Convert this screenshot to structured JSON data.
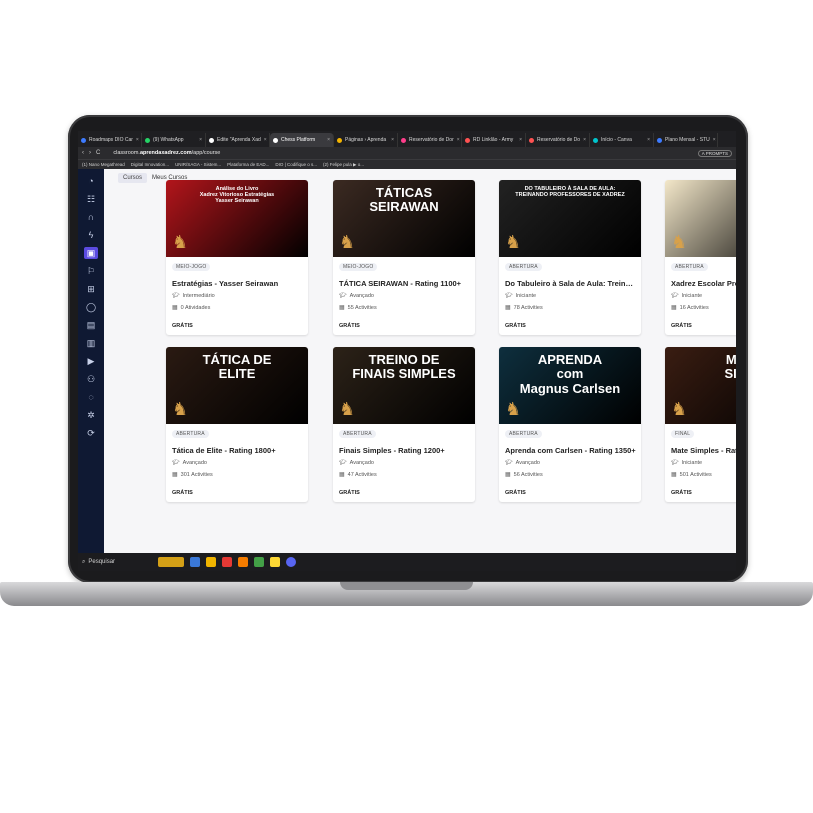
{
  "browser": {
    "tabs": [
      {
        "label": "Roadmaps DIO Car",
        "color": "#3d7bff"
      },
      {
        "label": "(9) WhatsApp",
        "color": "#25d366"
      },
      {
        "label": "Edite \"Aprenda Xad",
        "color": "#ffffff"
      },
      {
        "label": "Chess Platform",
        "color": "#ffffff",
        "active": true
      },
      {
        "label": "Páginas › Aprenda",
        "color": "#f4b400"
      },
      {
        "label": "Reservatório de Dor",
        "color": "#ff3d8b"
      },
      {
        "label": "RD Linklão - Army",
        "color": "#ff5252"
      },
      {
        "label": "Reservatório de Do",
        "color": "#ff5252"
      },
      {
        "label": "Início - Canva",
        "color": "#00c4cc"
      },
      {
        "label": "Plano Mensal - STU",
        "color": "#3d7bff"
      }
    ],
    "close_glyph": "×",
    "nav_back": "‹",
    "nav_forward": "›",
    "nav_reload": "C",
    "url_host": "classroom.",
    "url_domain": "aprendaxadrez.com",
    "url_path": "/app/course",
    "pill": "A PROMPTS",
    "bookmarks": [
      "(1) Nano Megathread",
      "Digital Innovation...",
      "UNIR/SAGA - Sistem...",
      "Plataforma de EAD...",
      "DIO | Codifique o s...",
      "(2) Felipe pula ▶ o..."
    ]
  },
  "subtabs": {
    "courses": "Cursos",
    "my_courses": "Meus Cursos"
  },
  "sidebar_icons": [
    "gauge-icon",
    "hierarchy-icon",
    "headset-icon",
    "bolt-icon",
    "book-icon",
    "flag-icon",
    "grid-icon",
    "ring-icon",
    "document-icon",
    "bar-chart-icon",
    "play-icon",
    "users-icon",
    "chat-icon",
    "gear-icon",
    "logout-icon"
  ],
  "courses": [
    {
      "thumb_title": "Análise do Livro\nXadrez Vitorioso Estratégias\nYasser Seirawan",
      "category": "MEIO-JOGO",
      "title": "Estratégias - Yasser Seirawan",
      "level": "Intermediário",
      "activities": "0 Atividades",
      "price": "GRÁTIS",
      "bg": "#b2151b"
    },
    {
      "thumb_title": "TÁTICAS\nSEIRAWAN",
      "category": "MEIO-JOGO",
      "title": "TÁTICA SEIRAWAN - Rating 1100+",
      "level": "Avançado",
      "activities": "55 Activities",
      "price": "GRÁTIS",
      "bg": "#3b2a22"
    },
    {
      "thumb_title": "DO TABULEIRO À SALA DE AULA:\nTREINANDO PROFESSORES DE XADREZ",
      "category": "ABERTURA",
      "title": "Do Tabuleiro à Sala de Aula: Treinan...",
      "level": "Iniciante",
      "activities": "78 Activities",
      "price": "GRÁTIS",
      "bg": "#222222"
    },
    {
      "thumb_title": "",
      "category": "ABERTURA",
      "title": "Xadrez Escolar Pro: Repe",
      "level": "Iniciante",
      "activities": "16 Activities",
      "price": "GRÁTIS",
      "bg": "#f3e7c9"
    },
    {
      "thumb_title": "TÁTICA DE\nELITE",
      "category": "ABERTURA",
      "title": "Tática de Elite - Rating 1800+",
      "level": "Avançado",
      "activities": "301 Activities",
      "price": "GRÁTIS",
      "bg": "#2a1a12"
    },
    {
      "thumb_title": "TREINO DE\nFINAIS SIMPLES",
      "category": "ABERTURA",
      "title": "Finais Simples - Rating 1200+",
      "level": "Avançado",
      "activities": "47 Activities",
      "price": "GRÁTIS",
      "bg": "#2c2218"
    },
    {
      "thumb_title": "APRENDA\ncom\nMagnus Carlsen",
      "category": "ABERTURA",
      "title": "Aprenda com Carlsen - Rating 1350+",
      "level": "Avançado",
      "activities": "56 Activities",
      "price": "GRÁTIS",
      "bg": "#0e2f3e"
    },
    {
      "thumb_title": "MA\nSIM",
      "category": "FINAL",
      "title": "Mate Simples - Rating 13",
      "level": "Iniciante",
      "activities": "501 Activities",
      "price": "GRÁTIS",
      "bg": "#3a1d12"
    }
  ],
  "taskbar": {
    "search": "Pesquisar"
  }
}
